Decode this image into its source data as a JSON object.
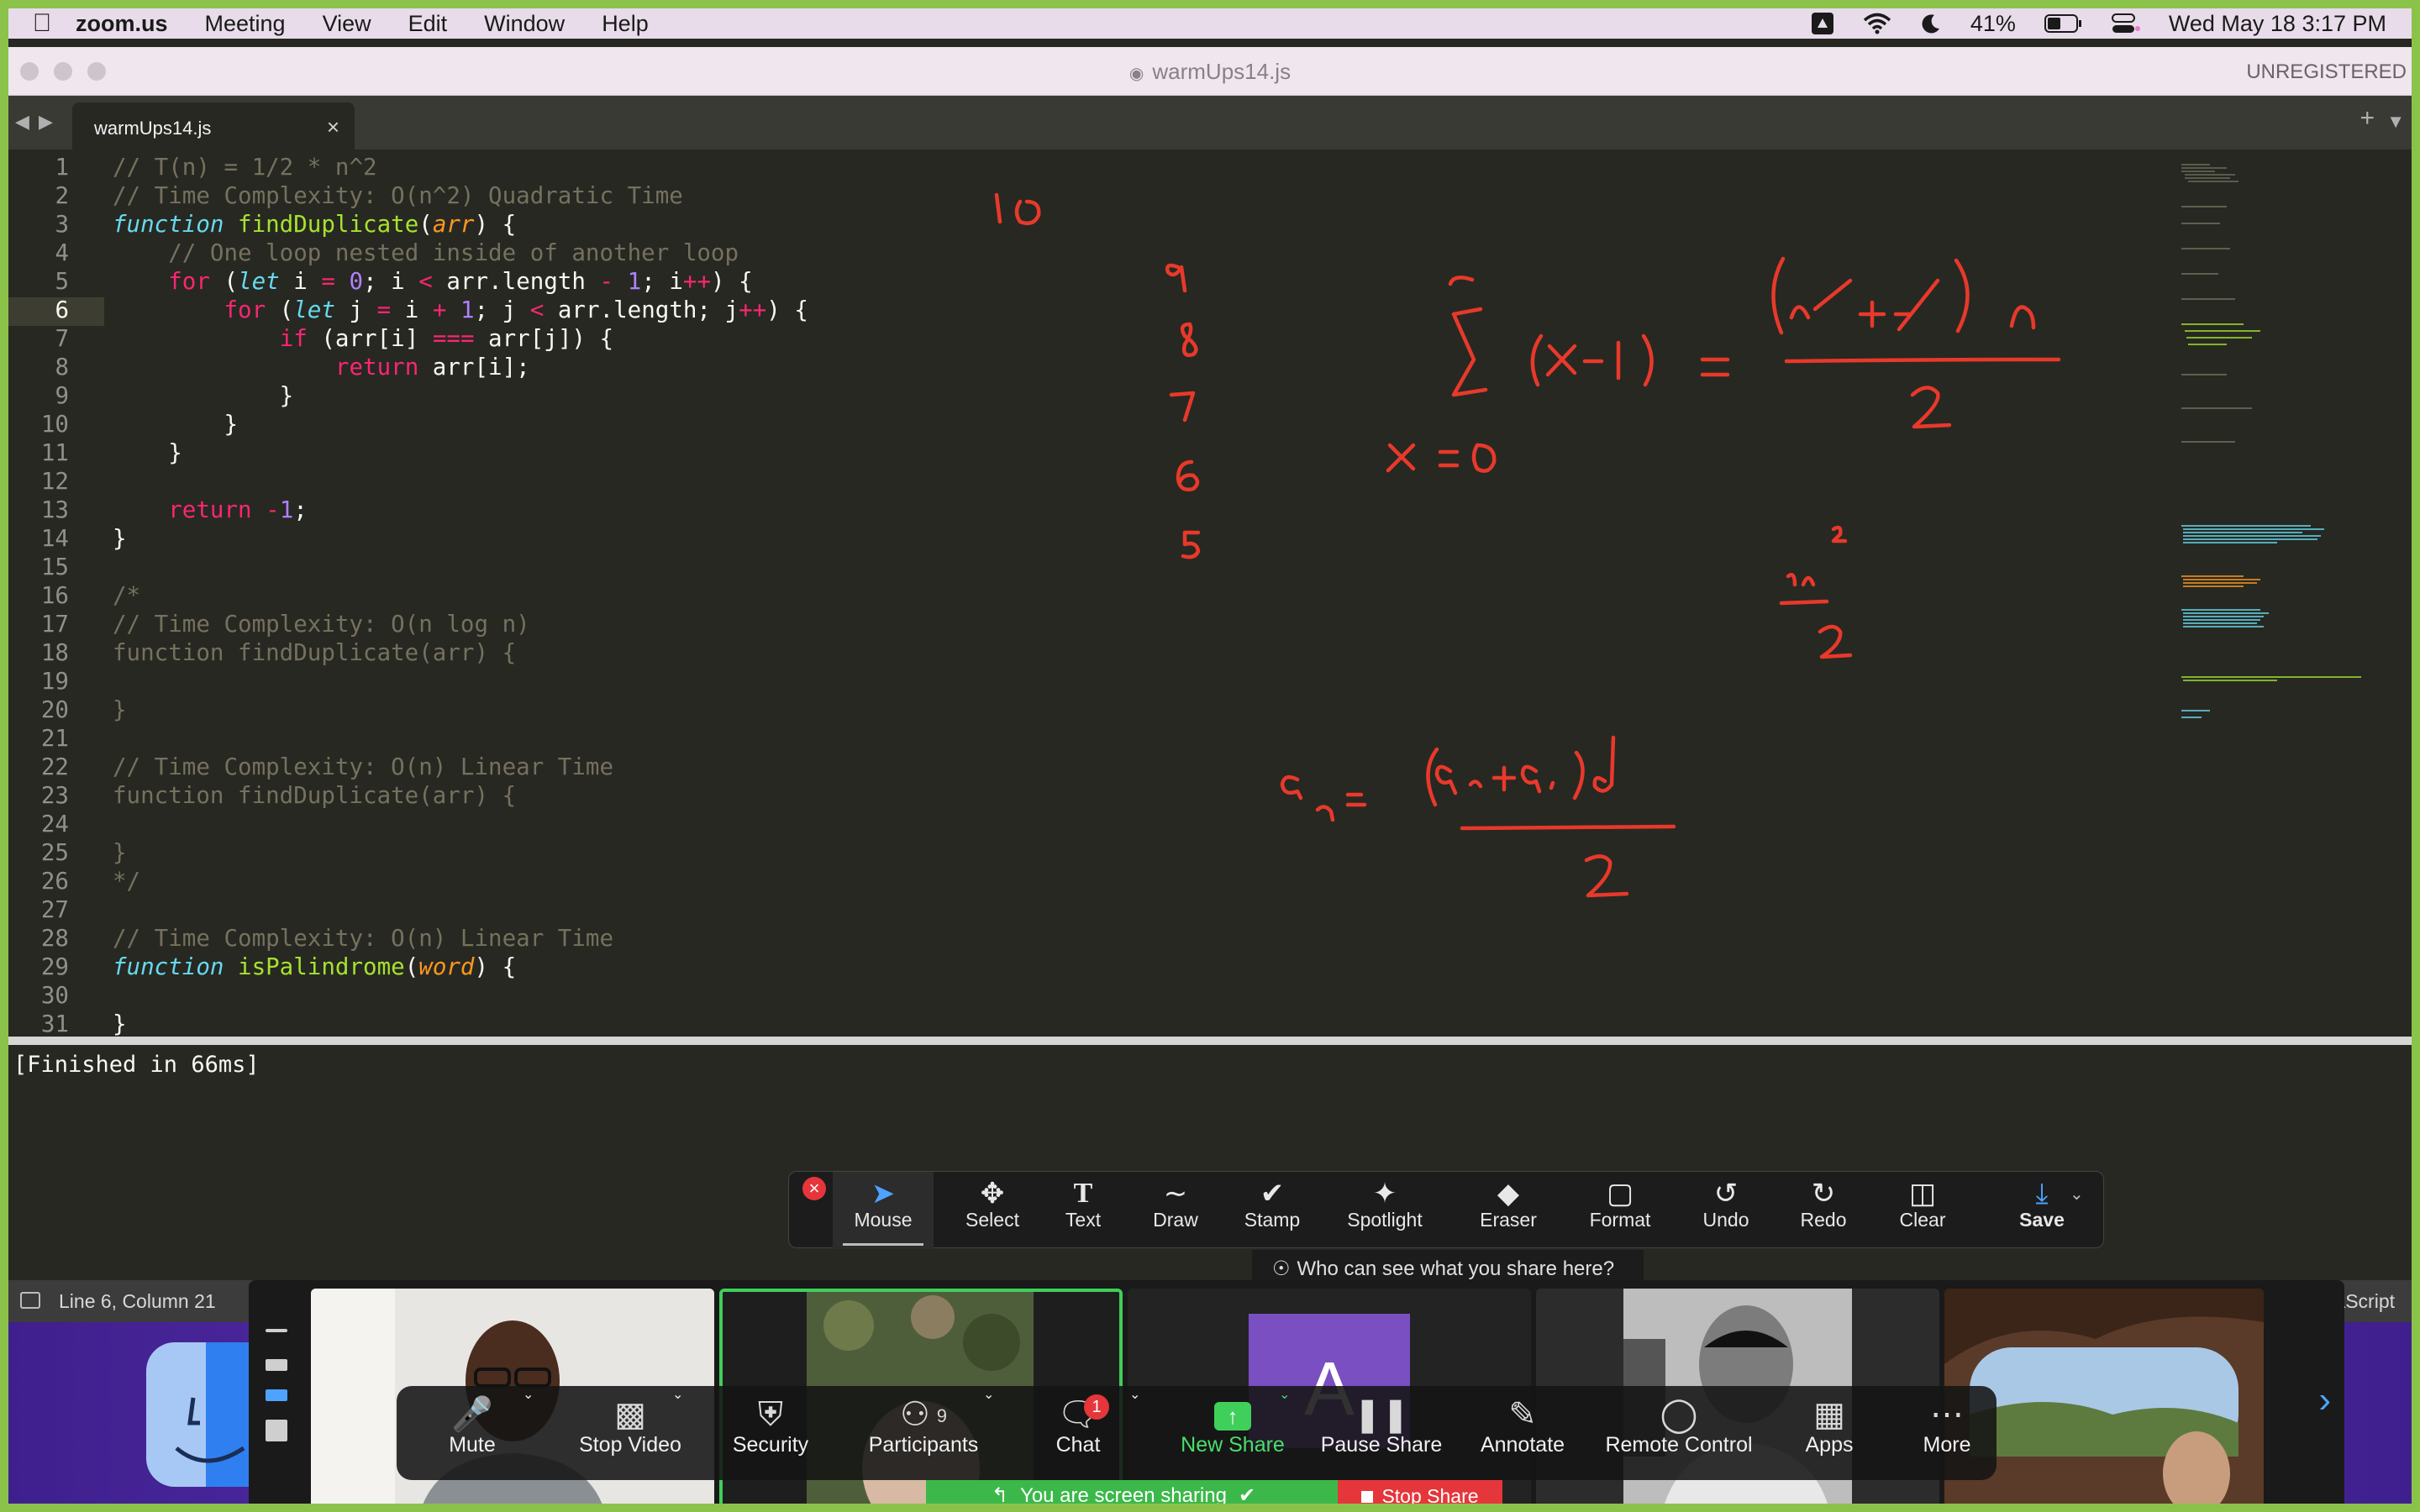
{
  "menubar": {
    "app": "zoom.us",
    "items": [
      "Meeting",
      "View",
      "Edit",
      "Window",
      "Help"
    ],
    "battery": "41%",
    "datetime": "Wed May 18  3:17 PM"
  },
  "window": {
    "title": "warmUps14.js",
    "badge": "UNREGISTERED"
  },
  "tab": {
    "label": "warmUps14.js",
    "close": "×"
  },
  "editor": {
    "line_numbers": [
      "1",
      "2",
      "3",
      "4",
      "5",
      "6",
      "7",
      "8",
      "9",
      "10",
      "11",
      "12",
      "13",
      "14",
      "15",
      "16",
      "17",
      "18",
      "19",
      "20",
      "21",
      "22",
      "23",
      "24",
      "25",
      "26",
      "27",
      "28",
      "29",
      "30",
      "31"
    ],
    "current_line": "6"
  },
  "output": {
    "text": "[Finished in 66ms]"
  },
  "statusbar": {
    "position": "Line 6, Column 21",
    "syntax": "JavaScript"
  },
  "annotate": {
    "tools": [
      {
        "label": "Mouse",
        "icon": "mouse-pointer-icon"
      },
      {
        "label": "Select",
        "icon": "move-icon"
      },
      {
        "label": "Text",
        "icon": "text-icon"
      },
      {
        "label": "Draw",
        "icon": "draw-icon"
      },
      {
        "label": "Stamp",
        "icon": "check-icon"
      },
      {
        "label": "Spotlight",
        "icon": "wand-icon"
      },
      {
        "label": "Eraser",
        "icon": "eraser-icon"
      },
      {
        "label": "Format",
        "icon": "square-icon"
      },
      {
        "label": "Undo",
        "icon": "undo-icon"
      },
      {
        "label": "Redo",
        "icon": "redo-icon"
      },
      {
        "label": "Clear",
        "icon": "trash-icon"
      },
      {
        "label": "Save",
        "icon": "download-icon"
      }
    ],
    "who_can_see": "Who can see what you share here?"
  },
  "controls": {
    "mute": "Mute",
    "stop_video": "Stop Video",
    "security": "Security",
    "participants": "Participants",
    "participants_count": "9",
    "chat": "Chat",
    "chat_badge": "1",
    "new_share": "New Share",
    "pause_share": "Pause Share",
    "annotate": "Annotate",
    "remote_control": "Remote Control",
    "apps": "Apps",
    "more": "More"
  },
  "share_banner": {
    "message": "You are screen sharing",
    "stop": "Stop Share"
  },
  "whiteboard": {
    "ink_color": "#e8392b",
    "notes": [
      "10",
      "9",
      "8",
      "7",
      "6",
      "5",
      "x = 0",
      "n",
      "2"
    ]
  },
  "colors": {
    "zoom_border": "#8bc34a",
    "editor_bg": "#272822",
    "accent": "#4da3ff",
    "danger": "#e5363b"
  }
}
